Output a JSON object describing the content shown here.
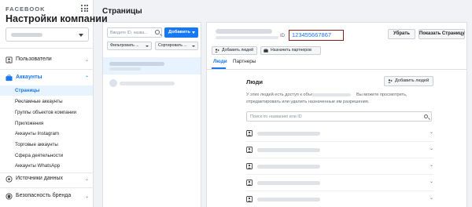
{
  "brand": "FACEBOOK",
  "sidebar": {
    "title": "Настройки компании",
    "sections": [
      {
        "label": "Пользователи",
        "icon": "users-icon"
      },
      {
        "label": "Аккаунты",
        "icon": "briefcase-icon"
      },
      {
        "label": "Источники данных",
        "icon": "data-sources-icon"
      },
      {
        "label": "Безопасность бренда",
        "icon": "shield-icon"
      }
    ],
    "sub_items": [
      "Страницы",
      "Рекламные аккаунты",
      "Группы объектов компании",
      "Приложения",
      "Аккаунты Instagram",
      "Торговые аккаунты",
      "Сфера деятельности",
      "Аккаунты WhatsApp"
    ],
    "selected_sub_item": "Страницы"
  },
  "header": {
    "title": "Страницы"
  },
  "list_panel": {
    "search_placeholder": "Введите ID, назва...",
    "add_button": "Добавить",
    "filter_button": "Фильтровать ...",
    "sort_button": "Сортировать ..."
  },
  "detail": {
    "id_label": "ID",
    "id_value": "123455667867",
    "remove_button": "Убрать",
    "show_page_button": "Показать Страницу",
    "add_people_button": "Добавить людей",
    "assign_partners_button": "Назначить партнеров",
    "tabs": [
      "Люди",
      "Партнеры"
    ],
    "active_tab": "Люди",
    "people": {
      "title": "Люди",
      "add_people_button": "Добавить людей",
      "desc_part1": "У этих людей есть доступ к объекту",
      "desc_part2": "Вы можете просмотреть,",
      "desc_line2": "отредактировать или удалить назначенные им разрешения.",
      "search_placeholder": "Поиск по названию или ID"
    }
  }
}
